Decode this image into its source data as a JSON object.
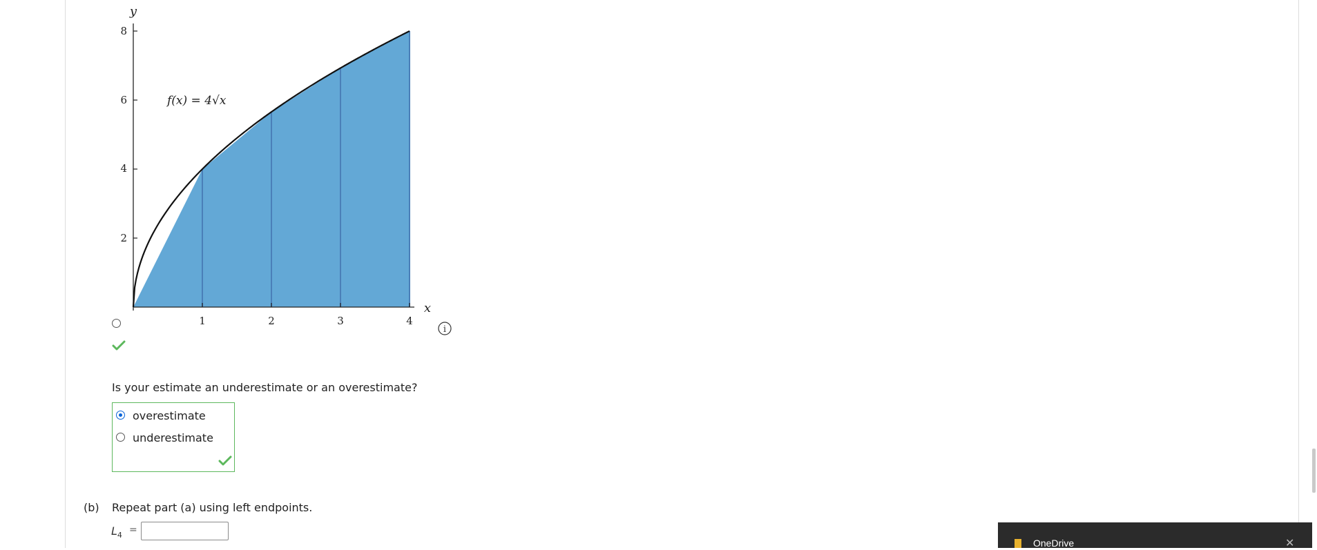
{
  "graph": {
    "function_label": "f(x) = 4√x",
    "x_axis_label": "x",
    "y_axis_label": "y",
    "x_ticks": [
      "1",
      "2",
      "3",
      "4"
    ],
    "y_ticks": [
      "2",
      "4",
      "6",
      "8"
    ],
    "info_icon": "info-icon",
    "fill_color": "#63a8d6"
  },
  "chart_data": {
    "type": "area",
    "function": "f(x) = 4√x",
    "x": [
      0,
      1,
      2,
      3,
      4
    ],
    "y": [
      0,
      4,
      5.657,
      6.928,
      8
    ],
    "xlim": [
      0,
      4
    ],
    "ylim": [
      0,
      8
    ],
    "xlabel": "x",
    "ylabel": "y",
    "grid": false
  },
  "question": {
    "text": "Is your estimate an underestimate or an overestimate?",
    "options": [
      {
        "label": "overestimate",
        "selected": true
      },
      {
        "label": "underestimate",
        "selected": false
      }
    ]
  },
  "part_b": {
    "label": "(b)",
    "text": "Repeat part (a) using left endpoints.",
    "var_name": "L",
    "var_sub": "4",
    "equals": "=",
    "input_value": ""
  },
  "toast": {
    "title": "OneDrive",
    "close": "✕"
  },
  "colors": {
    "check": "#5cb85c",
    "accent": "#0a64d8"
  }
}
